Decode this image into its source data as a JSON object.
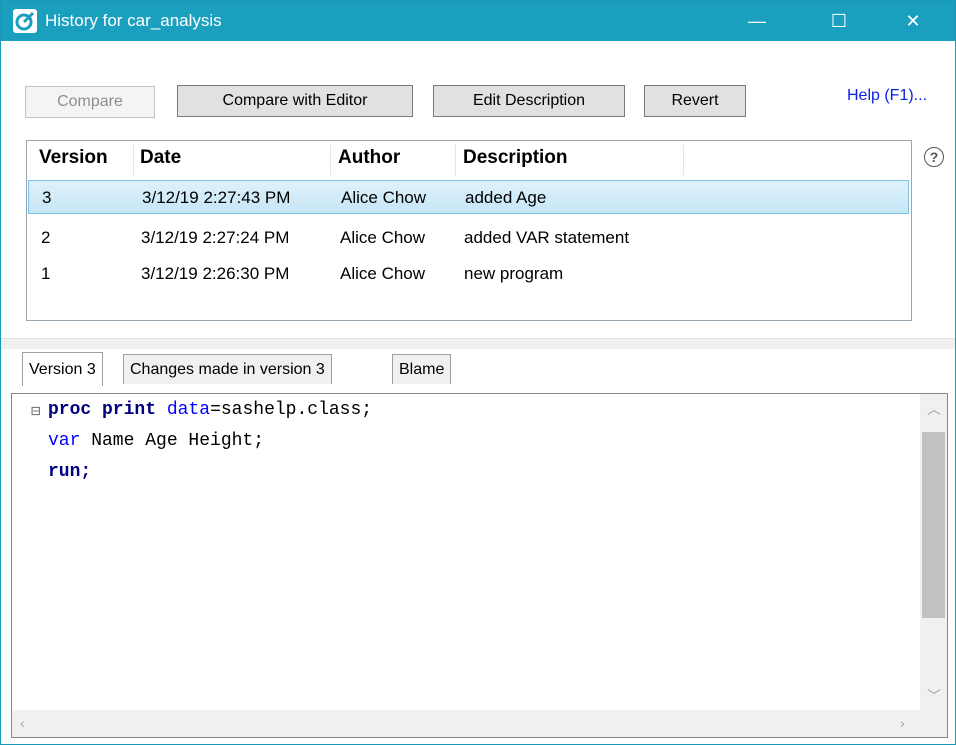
{
  "window": {
    "title": "History for car_analysis",
    "accent_color": "#1a9fbe",
    "controls": {
      "minimize": "—",
      "maximize": "☐",
      "close": "✕"
    }
  },
  "toolbar": {
    "compare_label": "Compare",
    "compare_with_editor_label": "Compare with Editor",
    "edit_description_label": "Edit Description",
    "revert_label": "Revert",
    "help_label": "Help (F1)...",
    "help_icon": "?"
  },
  "history": {
    "columns": [
      "Version",
      "Date",
      "Author",
      "Description"
    ],
    "rows": [
      {
        "version": "3",
        "date": "3/12/19 2:27:43 PM",
        "author": "Alice Chow",
        "description": "added Age",
        "selected": true
      },
      {
        "version": "2",
        "date": "3/12/19 2:27:24 PM",
        "author": "Alice Chow",
        "description": "added VAR statement",
        "selected": false
      },
      {
        "version": "1",
        "date": "3/12/19 2:26:30 PM",
        "author": "Alice Chow",
        "description": "new program",
        "selected": false
      }
    ]
  },
  "tabs": [
    {
      "label": "Version 3",
      "active": true
    },
    {
      "label": "Changes made in version 3",
      "active": false
    },
    {
      "label": "Blame",
      "active": false
    }
  ],
  "editor": {
    "fold_marker": "⊟",
    "lines": {
      "l1_kw": "proc print",
      "l1_opt": "data",
      "l1_rest": "=sashelp.class;",
      "l2_kw": "var",
      "l2_rest": " Name Age Height;",
      "l3_kw": "run;"
    }
  }
}
